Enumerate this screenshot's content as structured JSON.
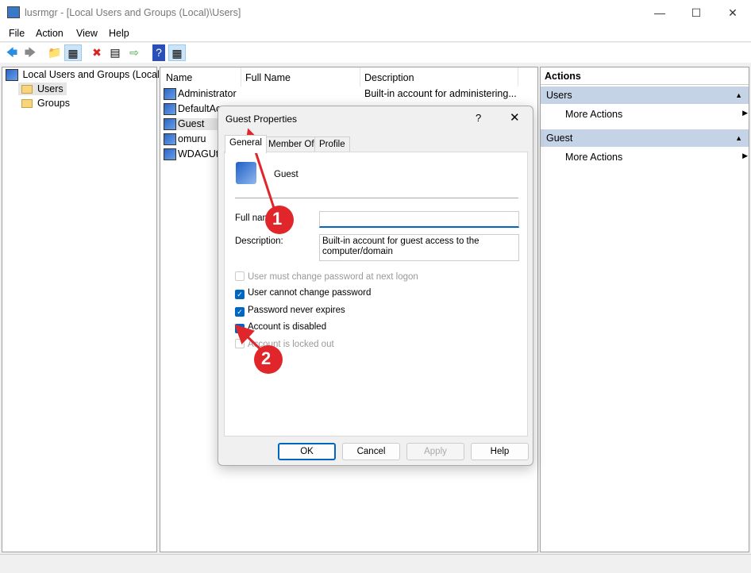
{
  "window": {
    "title": "lusrmgr - [Local Users and Groups (Local)\\Users]"
  },
  "menu": [
    "File",
    "Action",
    "View",
    "Help"
  ],
  "tree": {
    "root": "Local Users and Groups (Local)",
    "items": [
      "Users",
      "Groups"
    ],
    "selected": "Users"
  },
  "list": {
    "columns": [
      "Name",
      "Full Name",
      "Description"
    ],
    "rows": [
      {
        "name": "Administrator",
        "full": "",
        "desc": "Built-in account for administering..."
      },
      {
        "name": "DefaultAc",
        "full": "",
        "desc": ""
      },
      {
        "name": "Guest",
        "full": "",
        "desc": ""
      },
      {
        "name": "omuru",
        "full": "",
        "desc": ""
      },
      {
        "name": "WDAGUti",
        "full": "",
        "desc": ""
      }
    ]
  },
  "actions": {
    "title": "Actions",
    "sections": [
      {
        "header": "Users",
        "item": "More Actions"
      },
      {
        "header": "Guest",
        "item": "More Actions"
      }
    ]
  },
  "dialog": {
    "title": "Guest Properties",
    "help": "?",
    "tabs": [
      "General",
      "Member Of",
      "Profile"
    ],
    "active_tab": "General",
    "user": "Guest",
    "fullname_label": "Full name:",
    "fullname_value": "",
    "description_label": "Description:",
    "description_value": "Built-in account for guest access to the computer/domain",
    "checkboxes": [
      {
        "label": "User must change password at next logon",
        "checked": false,
        "disabled": true
      },
      {
        "label": "User cannot change password",
        "checked": true,
        "disabled": false
      },
      {
        "label": "Password never expires",
        "checked": true,
        "disabled": false
      },
      {
        "label": "Account is disabled",
        "checked": true,
        "disabled": false
      },
      {
        "label": "Account is locked out",
        "checked": false,
        "disabled": true
      }
    ],
    "buttons": [
      "OK",
      "Cancel",
      "Apply",
      "Help"
    ]
  },
  "annotations": [
    "1",
    "2"
  ],
  "colors": {
    "accent": "#0067c0",
    "annotation": "#e0262b"
  }
}
